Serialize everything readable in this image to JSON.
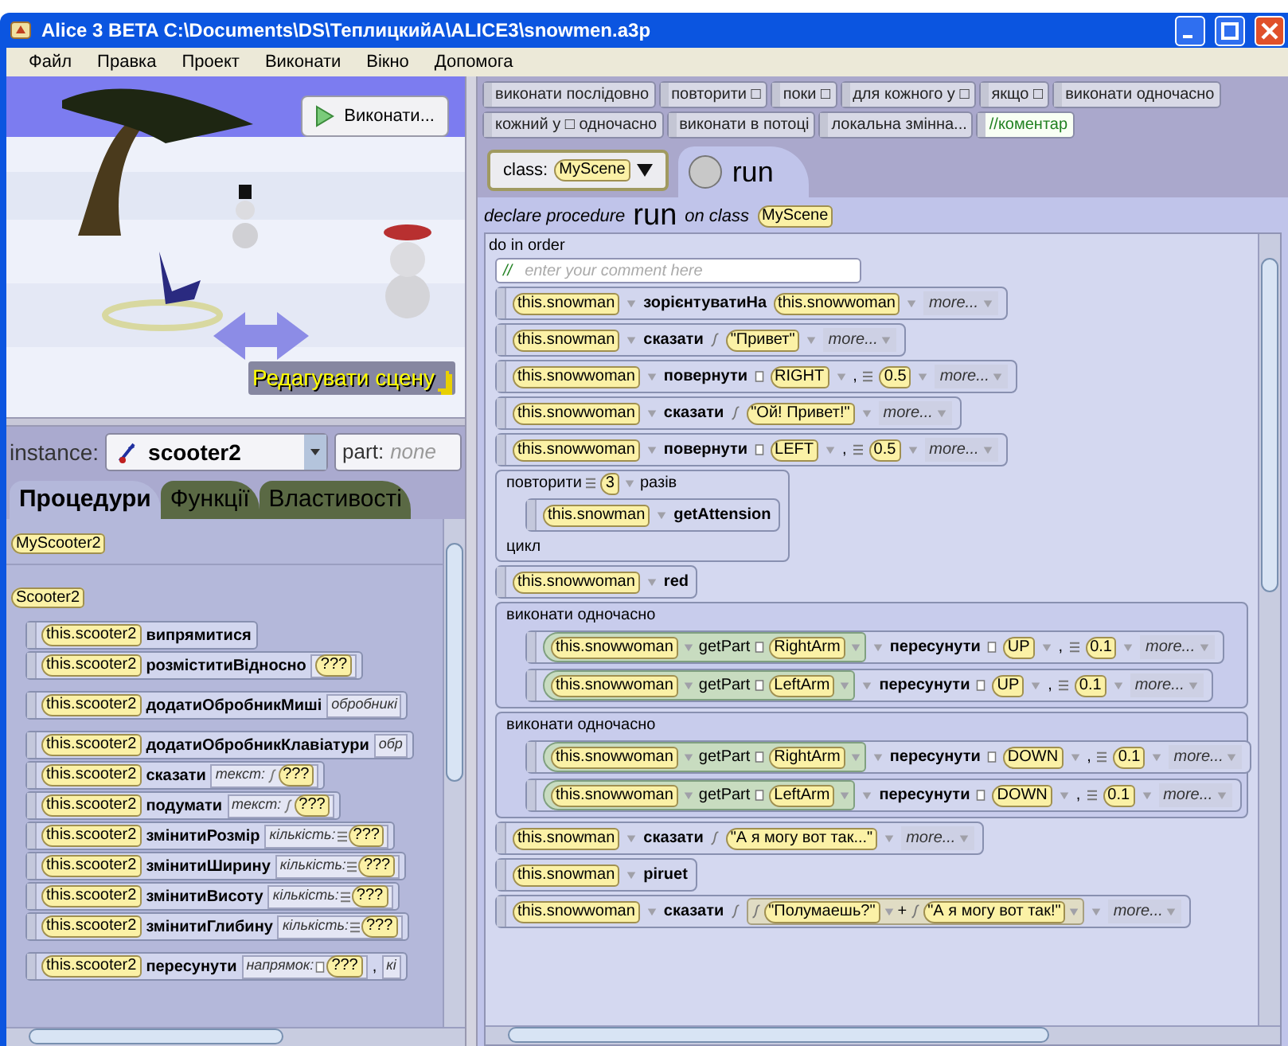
{
  "window": {
    "title": "Alice 3 BETA C:\\Documents\\DS\\ТеплицкийА\\ALICE3\\snowmen.a3p"
  },
  "menu": [
    "Файл",
    "Правка",
    "Проект",
    "Виконати",
    "Вікно",
    "Допомога"
  ],
  "scene": {
    "kind": "picture",
    "run_button": "Виконати...",
    "edit_button": "Редагувати сцену"
  },
  "instance": {
    "label": "instance:",
    "value": "scooter2",
    "part_label": "part:",
    "part_value": "none"
  },
  "tabs": [
    {
      "label": "Процедури",
      "selected": true
    },
    {
      "label": "Функції",
      "selected": false
    },
    {
      "label": "Властивості",
      "selected": false
    }
  ],
  "palette": {
    "class_tile": "MyScooter2",
    "group_tile": "Scooter2",
    "groups": [
      [
        {
          "target": "this.scooter2",
          "name": "випрямитися"
        },
        {
          "target": "this.scooter2",
          "name": "розміститиВідносно",
          "params": [
            {
              "kind": "object",
              "value": "???"
            }
          ]
        }
      ],
      [
        {
          "target": "this.scooter2",
          "name": "додатиОбробникМиші",
          "params": [
            {
              "label": "обробникі"
            }
          ]
        }
      ],
      [
        {
          "target": "this.scooter2",
          "name": "додатиОбробникКлавіатури",
          "params": [
            {
              "label": "обр"
            }
          ]
        },
        {
          "target": "this.scooter2",
          "name": "сказати",
          "params": [
            {
              "label": "текст:",
              "kind": "string",
              "value": "???"
            }
          ]
        },
        {
          "target": "this.scooter2",
          "name": "подумати",
          "params": [
            {
              "label": "текст:",
              "kind": "string",
              "value": "???"
            }
          ]
        },
        {
          "target": "this.scooter2",
          "name": "змінитиРозмір",
          "params": [
            {
              "label": "кількість:",
              "kind": "number",
              "value": "???"
            }
          ]
        },
        {
          "target": "this.scooter2",
          "name": "змінитиШирину",
          "params": [
            {
              "label": "кількість:",
              "kind": "number",
              "value": "???"
            }
          ]
        },
        {
          "target": "this.scooter2",
          "name": "змінитиВисоту",
          "params": [
            {
              "label": "кількість:",
              "kind": "number",
              "value": "???"
            }
          ]
        },
        {
          "target": "this.scooter2",
          "name": "змінитиГлибину",
          "params": [
            {
              "label": "кількість:",
              "kind": "number",
              "value": "???"
            }
          ]
        }
      ],
      [
        {
          "target": "this.scooter2",
          "name": "пересунути",
          "params": [
            {
              "label": "напрямок:",
              "kind": "enum",
              "value": "???"
            },
            {
              "separator": ",",
              "label": "кі"
            }
          ]
        }
      ]
    ]
  },
  "blocks": [
    {
      "kind": "block",
      "label": "виконати послідовно"
    },
    {
      "kind": "block",
      "label": "повторити □"
    },
    {
      "kind": "block",
      "label": "поки □"
    },
    {
      "kind": "block",
      "label": "для кожного у □"
    },
    {
      "kind": "block",
      "label": "якщо □"
    },
    {
      "kind": "block",
      "label": "виконати одночасно"
    },
    {
      "kind": "block",
      "label": "кожний у □ одночасно"
    },
    {
      "kind": "block",
      "label": "виконати в потоці"
    },
    {
      "kind": "block",
      "label": "локальна змінна..."
    },
    {
      "kind": "comment",
      "label": "//коментар"
    }
  ],
  "class_selector": {
    "label": "class:",
    "value": "MyScene"
  },
  "method_tab": {
    "label": "run",
    "selected": true
  },
  "declaration": {
    "prefix": "declare procedure",
    "name": "run",
    "middle": "on class",
    "class": "MyScene"
  },
  "code": {
    "header": "do in order",
    "statements": [
      {
        "kind": "comment",
        "marker": "//",
        "placeholder": "enter your comment here"
      },
      {
        "kind": "call",
        "target": {
          "object": "this.snowman"
        },
        "method": "зорієнтуватиНа",
        "args": [
          {
            "kind": "object",
            "value": "this.snowwoman"
          }
        ],
        "more": "more..."
      },
      {
        "kind": "call",
        "target": {
          "object": "this.snowman"
        },
        "method": "сказати",
        "args": [
          {
            "kind": "string",
            "value": "\"Привет\""
          }
        ],
        "more": "more..."
      },
      {
        "kind": "call",
        "target": {
          "object": "this.snowwoman"
        },
        "method": "повернути",
        "args": [
          {
            "kind": "enum",
            "value": "RIGHT"
          },
          {
            "kind": "number",
            "value": "0.5",
            "separator": ","
          }
        ],
        "more": "more..."
      },
      {
        "kind": "call",
        "target": {
          "object": "this.snowwoman"
        },
        "method": "сказати",
        "args": [
          {
            "kind": "string",
            "value": "\"Ой! Привет!\""
          }
        ],
        "more": "more..."
      },
      {
        "kind": "call",
        "target": {
          "object": "this.snowwoman"
        },
        "method": "повернути",
        "args": [
          {
            "kind": "enum",
            "value": "LEFT"
          },
          {
            "kind": "number",
            "value": "0.5",
            "separator": ","
          }
        ],
        "more": "more..."
      },
      {
        "kind": "repeat",
        "label": "повторити",
        "count": "3",
        "suffix": "разів",
        "footer": "цикл",
        "body": [
          {
            "kind": "call",
            "target": {
              "object": "this.snowman"
            },
            "method": "getAttension"
          }
        ]
      },
      {
        "kind": "call",
        "target": {
          "object": "this.snowwoman"
        },
        "method": "red"
      },
      {
        "kind": "parallel",
        "label": "виконати одночасно",
        "body": [
          {
            "kind": "call",
            "target": {
              "object": "this.snowwoman",
              "method": "getPart",
              "part": "RightArm"
            },
            "method": "пересунути",
            "args": [
              {
                "kind": "enum",
                "value": "UP"
              },
              {
                "kind": "number",
                "value": "0.1",
                "separator": ","
              }
            ],
            "more": "more..."
          },
          {
            "kind": "call",
            "target": {
              "object": "this.snowwoman",
              "method": "getPart",
              "part": "LeftArm"
            },
            "method": "пересунути",
            "args": [
              {
                "kind": "enum",
                "value": "UP"
              },
              {
                "kind": "number",
                "value": "0.1",
                "separator": ","
              }
            ],
            "more": "more..."
          }
        ]
      },
      {
        "kind": "parallel",
        "label": "виконати одночасно",
        "body": [
          {
            "kind": "call",
            "target": {
              "object": "this.snowwoman",
              "method": "getPart",
              "part": "RightArm"
            },
            "method": "пересунути",
            "args": [
              {
                "kind": "enum",
                "value": "DOWN"
              },
              {
                "kind": "number",
                "value": "0.1",
                "separator": ","
              }
            ],
            "more": "more..."
          },
          {
            "kind": "call",
            "target": {
              "object": "this.snowwoman",
              "method": "getPart",
              "part": "LeftArm"
            },
            "method": "пересунути",
            "args": [
              {
                "kind": "enum",
                "value": "DOWN"
              },
              {
                "kind": "number",
                "value": "0.1",
                "separator": ","
              }
            ],
            "more": "more..."
          }
        ]
      },
      {
        "kind": "call",
        "target": {
          "object": "this.snowman"
        },
        "method": "сказати",
        "args": [
          {
            "kind": "string",
            "value": "\"А я могу вот так...\""
          }
        ],
        "more": "more..."
      },
      {
        "kind": "call",
        "target": {
          "object": "this.snowman"
        },
        "method": "piruet"
      },
      {
        "kind": "call",
        "target": {
          "object": "this.snowwoman"
        },
        "method": "сказати",
        "args": [
          {
            "kind": "concat",
            "operator": "+",
            "parts": [
              {
                "kind": "string",
                "value": "\"Полумаешь?\""
              },
              {
                "kind": "string",
                "value": "\"А я могу вот так!\""
              }
            ]
          }
        ],
        "more": "more..."
      }
    ]
  }
}
